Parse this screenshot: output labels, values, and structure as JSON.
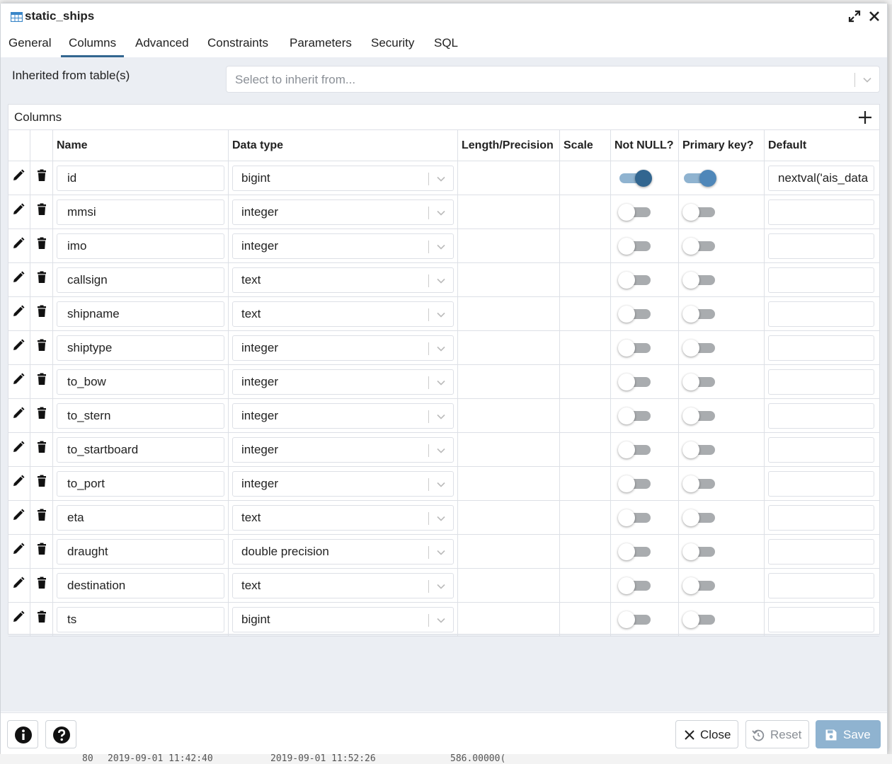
{
  "dialog": {
    "title": "static_ships",
    "icons": {
      "title": "table-icon",
      "maximize": "expand-icon",
      "close": "close-icon"
    }
  },
  "tabs": [
    "General",
    "Columns",
    "Advanced",
    "Constraints",
    "Parameters",
    "Security",
    "SQL"
  ],
  "active_tab": "Columns",
  "inherit": {
    "label": "Inherited from table(s)",
    "placeholder": "Select to inherit from..."
  },
  "columns_panel": {
    "title": "Columns",
    "headers": {
      "name": "Name",
      "data_type": "Data type",
      "length": "Length/Precision",
      "scale": "Scale",
      "not_null": "Not NULL?",
      "primary_key": "Primary key?",
      "default": "Default"
    },
    "rows": [
      {
        "name": "id",
        "data_type": "bigint",
        "not_null": true,
        "primary_key": true,
        "default": "nextval('ais_data"
      },
      {
        "name": "mmsi",
        "data_type": "integer",
        "not_null": false,
        "primary_key": false,
        "default": ""
      },
      {
        "name": "imo",
        "data_type": "integer",
        "not_null": false,
        "primary_key": false,
        "default": ""
      },
      {
        "name": "callsign",
        "data_type": "text",
        "not_null": false,
        "primary_key": false,
        "default": ""
      },
      {
        "name": "shipname",
        "data_type": "text",
        "not_null": false,
        "primary_key": false,
        "default": ""
      },
      {
        "name": "shiptype",
        "data_type": "integer",
        "not_null": false,
        "primary_key": false,
        "default": ""
      },
      {
        "name": "to_bow",
        "data_type": "integer",
        "not_null": false,
        "primary_key": false,
        "default": ""
      },
      {
        "name": "to_stern",
        "data_type": "integer",
        "not_null": false,
        "primary_key": false,
        "default": ""
      },
      {
        "name": "to_startboard",
        "data_type": "integer",
        "not_null": false,
        "primary_key": false,
        "default": ""
      },
      {
        "name": "to_port",
        "data_type": "integer",
        "not_null": false,
        "primary_key": false,
        "default": ""
      },
      {
        "name": "eta",
        "data_type": "text",
        "not_null": false,
        "primary_key": false,
        "default": ""
      },
      {
        "name": "draught",
        "data_type": "double precision",
        "not_null": false,
        "primary_key": false,
        "default": ""
      },
      {
        "name": "destination",
        "data_type": "text",
        "not_null": false,
        "primary_key": false,
        "default": ""
      },
      {
        "name": "ts",
        "data_type": "bigint",
        "not_null": false,
        "primary_key": false,
        "default": ""
      }
    ]
  },
  "footer": {
    "close_label": "Close",
    "reset_label": "Reset",
    "save_label": "Save"
  },
  "background_query_row": {
    "row_num": "80",
    "start": "2019-09-01 11:42:40",
    "end": "2019-09-01 11:52:26",
    "value": "586.00000("
  },
  "colors": {
    "accent": "#326690",
    "save_bg": "#8fb3d0",
    "panel_bg": "#ebeef3"
  }
}
